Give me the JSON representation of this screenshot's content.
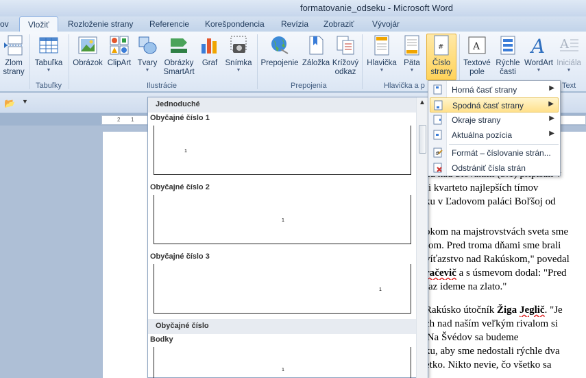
{
  "window": {
    "title": "formatovanie_odseku  -  Microsoft Word"
  },
  "tabs": [
    {
      "label": "ov"
    },
    {
      "label": "Vložiť",
      "active": true
    },
    {
      "label": "Rozloženie strany"
    },
    {
      "label": "Referencie"
    },
    {
      "label": "Korešpondencia"
    },
    {
      "label": "Revízia"
    },
    {
      "label": "Zobraziť"
    },
    {
      "label": "Vývojár"
    }
  ],
  "ribbon": {
    "buttons": {
      "zlom": {
        "l1": "Zlom",
        "l2": "strany"
      },
      "tabulka": {
        "l1": "Tabuľka"
      },
      "obrazok": {
        "l1": "Obrázok"
      },
      "clipart": {
        "l1": "ClipArt"
      },
      "tvary": {
        "l1": "Tvary"
      },
      "smartart": {
        "l1": "Obrázky",
        "l2": "SmartArt"
      },
      "graf": {
        "l1": "Graf"
      },
      "snimka": {
        "l1": "Snímka"
      },
      "prepojenie": {
        "l1": "Prepojenie"
      },
      "zalozka": {
        "l1": "Záložka"
      },
      "krizovy": {
        "l1": "Krížový",
        "l2": "odkaz"
      },
      "hlavicka": {
        "l1": "Hlavička"
      },
      "pata": {
        "l1": "Päta"
      },
      "cislo": {
        "l1": "Číslo",
        "l2": "strany"
      },
      "textove": {
        "l1": "Textové",
        "l2": "pole"
      },
      "rychle": {
        "l1": "Rýchle",
        "l2": "časti"
      },
      "wordart": {
        "l1": "WordArt"
      },
      "inicialy": {
        "l1": "Iniciála"
      }
    },
    "groups": {
      "tabulky": "Tabuľky",
      "ilustracie": "Ilustrácie",
      "prepojenia": "Prepojenia",
      "hlavicka": "Hlavička a p",
      "text": "Text"
    }
  },
  "ruler": {
    "ticks": [
      "2",
      "1"
    ]
  },
  "gallery": {
    "section1": "Jednoduché",
    "items": [
      {
        "title": "Obyčajné číslo 1",
        "num": "1"
      },
      {
        "title": "Obyčajné číslo 2",
        "num": "1"
      },
      {
        "title": "Obyčajné číslo 3",
        "num": "1"
      }
    ],
    "section2": "Obyčajné číslo",
    "item4": {
      "title": "Bodky",
      "num": "1"
    }
  },
  "menu": {
    "items": [
      {
        "label": "Horná časť strany",
        "submenu": true
      },
      {
        "label": "Spodná časť strany",
        "submenu": true,
        "highlighted": true
      },
      {
        "label": "Okraje strany",
        "submenu": true
      },
      {
        "label": "Aktuálna pozícia",
        "submenu": true
      },
      {
        "label": "Formát – číslovanie strán..."
      },
      {
        "label": "Odstrániť čísla strán"
      }
    ]
  },
  "document": {
    "p1": [
      "nu nad Slovákmi (3:1) pripísali  v",
      "ri kvarteto najlepších  tímov",
      "ku v Ľadovom paláci Boľšoj od"
    ],
    "p2a": [
      "okom na majstrovstvách sveta sme",
      "rom. Pred troma dňami sme brali",
      "víťazstvo nad Rakúskom,\" povedal"
    ],
    "p2b": {
      "name": "račevič",
      "rest": " a s úsmevom dodal: \"Pred"
    },
    "p2c": "raz ideme na zlato.\"",
    "p3a": {
      "pre": "Rakúsko útočník ",
      "name1": "Žiga",
      "mid": " ",
      "name2": "Jeglič",
      "post": ". \"Je"
    },
    "p3": [
      "ch nad naším  veľkým rivalom si",
      "'Na Švédov sa budeme",
      "ku, aby sme nedostali rýchle dva",
      "etko. Nikto nevie, čo všetko sa"
    ]
  },
  "colors": {
    "accent": "#ffd35a",
    "menuHighlight": "#ffe18c",
    "ribbonBg": "#e4ecf7"
  }
}
